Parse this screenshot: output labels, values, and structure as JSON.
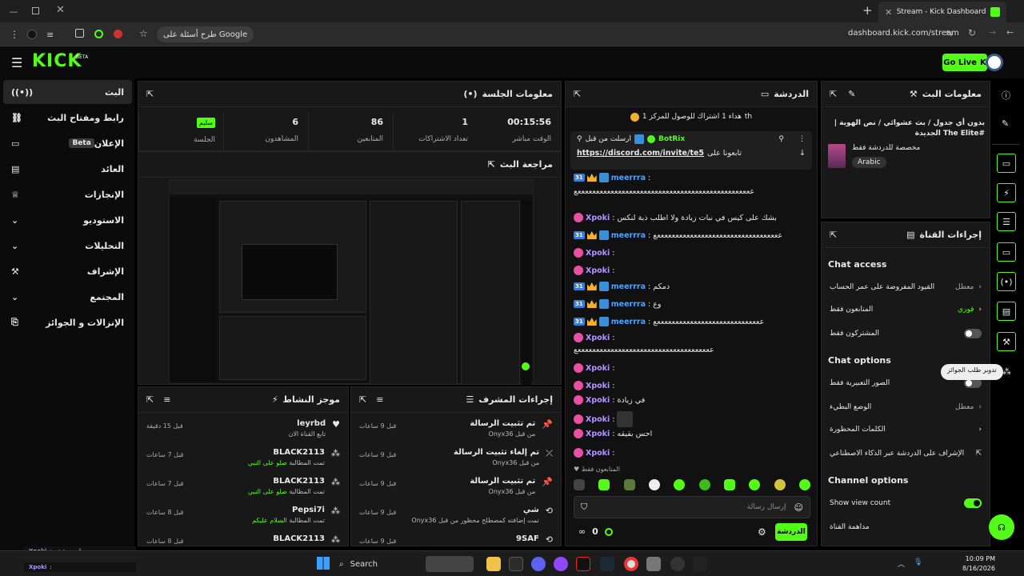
{
  "browser": {
    "tab_title": "Stream - Kick Dashboard",
    "url": "dashboard.kick.com/stream",
    "google_chip": "طرح أسئلة على Google"
  },
  "header": {
    "logo": "KICK",
    "logo_tag": "BETA",
    "go_live": "Go Live"
  },
  "nav": {
    "items": [
      {
        "label": "البث",
        "active": true
      },
      {
        "label": "رابط ومفتاح البث"
      },
      {
        "label": "الإعلان",
        "badge": "Beta"
      },
      {
        "label": "العائد"
      },
      {
        "label": "الإنجازات"
      },
      {
        "label": "الاستوديو"
      },
      {
        "label": "التحليلات"
      },
      {
        "label": "الإشراف"
      },
      {
        "label": "المجتمع"
      },
      {
        "label": "الإنزالات و الجوائز"
      }
    ]
  },
  "session": {
    "title": "معلومات الجلسة",
    "stats": [
      {
        "value": "00:15:56",
        "label": "الوقت مباشر"
      },
      {
        "value": "1",
        "label": "تعداد الاشتراكات"
      },
      {
        "value": "86",
        "label": "المتابعين"
      },
      {
        "value": "6",
        "label": "المشاهدون"
      }
    ],
    "session_label": "الجلسة",
    "session_badge": "سليم"
  },
  "preview": {
    "title": "مراجعة البث"
  },
  "activity": {
    "title": "موجز النشاط",
    "items": [
      {
        "name": "leyrbd",
        "sub": "تابع القناة الان",
        "time": "قبل 15 دقيقة"
      },
      {
        "name": "BLACK2113",
        "sub": "تمت المطالبة",
        "extra": "صلو على النبي",
        "time": "قبل 7 ساعات"
      },
      {
        "name": "BLACK2113",
        "sub": "تمت المطالبة",
        "extra": "صلو على النبي",
        "time": "قبل 7 ساعات"
      },
      {
        "name": "Pepsi7i",
        "sub": "تمت المطالبة",
        "extra": "السلام عليكم",
        "time": "قبل 8 ساعات"
      },
      {
        "name": "BLACK2113",
        "sub": "",
        "time": "قبل 8 ساعات"
      }
    ]
  },
  "mod": {
    "title": "إجراءات المشرف",
    "items": [
      {
        "name": "تم تثبيت الرسالة",
        "sub": "من قبل Onyx36",
        "time": "قبل 9 ساعات"
      },
      {
        "name": "تم إلغاء تثبيت الرسالة",
        "sub": "من قبل Onyx36",
        "time": "قبل 9 ساعات"
      },
      {
        "name": "تم تثبيت الرسالة",
        "sub": "من قبل Onyx36",
        "time": "قبل 9 ساعات"
      },
      {
        "name": "شي",
        "sub": "تمت إضافته كمصطلح محظور من قبل Onyx36",
        "time": "قبل 9 ساعات"
      },
      {
        "name": "9SAF",
        "sub": "",
        "time": "قبل 9 ساعات"
      }
    ]
  },
  "chat": {
    "title": "الدردشة",
    "goal": "هداء 1 اشتراك للوصول للمركز 1",
    "goal_suffix": "th",
    "pinned_by": "BotRix",
    "pinned_label": "ارسلت من قبل",
    "pinned_text": "تابعونا على",
    "pinned_link": "https://discord.com/invite/te5",
    "lines": [
      {
        "user": "meerrra",
        "text": "ععععععععععععععععععععععععععععععععععععععععععععععععع"
      },
      {
        "user": "Xpoki",
        "text": "بشك على كيس في نبات زيادة ولا اطلب ذبة لنكس"
      },
      {
        "user": "meerrra",
        "text": "ععععععععععععععععععععععععععععععععععع"
      },
      {
        "user": "Xpoki",
        "text": ""
      },
      {
        "user": "Xpoki",
        "text": ""
      },
      {
        "user": "meerrra",
        "text": "دمكم"
      },
      {
        "user": "meerrra",
        "text": "وع"
      },
      {
        "user": "meerrra",
        "text": "عععععععععععععععععععععععععععععع"
      },
      {
        "user": "Xpoki",
        "text": "عععععععععععععععععععععععععععععععععععععع"
      },
      {
        "user": "Xpoki",
        "text": ""
      },
      {
        "user": "Xpoki",
        "text": ""
      },
      {
        "user": "Xpoki",
        "text": "في زيادة"
      },
      {
        "user": "Xpoki",
        "text": ""
      },
      {
        "user": "Xpoki",
        "text": "احس بقيقه"
      },
      {
        "user": "Xpoki",
        "text": ""
      }
    ],
    "followers_only": "المتابعون فقط",
    "input_placeholder": "إرسال رسالة",
    "send": "الدردشة",
    "count": "0"
  },
  "stream_info": {
    "title": "معلومات البث",
    "stream_title": "بدون أي جدول / بث عشوائي / نص الهوية | #The Elite الجديدة",
    "category": "مخصصة للدردشة فقط",
    "language": "Arabic"
  },
  "channel": {
    "title": "إجراءات القناة",
    "chat_access": "Chat access",
    "access_rows": [
      {
        "label": "القيود المفروضة على عمر الحساب",
        "value": "معطل"
      },
      {
        "label": "المتابعون فقط",
        "value": "فوري"
      },
      {
        "label": "المشتركون فقط",
        "value": ""
      }
    ],
    "chat_options": "Chat options",
    "option_rows": [
      {
        "label": "الصور التعبيرية فقط",
        "value": ""
      },
      {
        "label": "الوضع البطيء",
        "value": "معطل"
      },
      {
        "label": "الكلمات المحظورة",
        "value": ""
      },
      {
        "label": "الإشراف على الدردشة عبر الذكاء الاصطناعي",
        "value": ""
      }
    ],
    "channel_options": "Channel options",
    "show_view_count": "Show view count",
    "channel_raid": "مداهمة القناة",
    "tooltip": "تدوير طلب الجوائز"
  },
  "overlay": [
    {
      "user": "Xpoki",
      "text": "احس بقيقه"
    },
    {
      "user": "Xpoki",
      "text": ""
    }
  ],
  "taskbar": {
    "search": "Search",
    "time": "10:09 PM",
    "date": "8/16/2026"
  }
}
